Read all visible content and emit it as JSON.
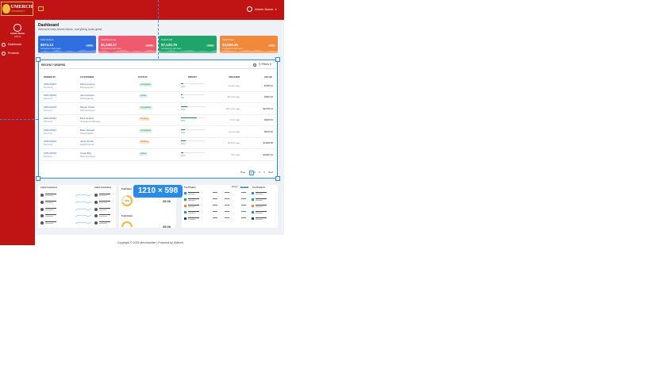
{
  "app": {
    "logo_text": "UMERCH",
    "logo_subtext": "UNIVERSITY",
    "menu_toggle_icon": "menu-icon"
  },
  "sidebar": {
    "user_icon": "user-circle-icon",
    "user_name": "Admin Name",
    "user_role": "Admin",
    "items": [
      {
        "label": "Dashboard",
        "icon": "dashboard-icon"
      },
      {
        "label": "Products",
        "icon": "box-icon"
      }
    ]
  },
  "header": {
    "admin_label": "Admin Name",
    "admin_icon": "user-circle-icon",
    "chevron_icon": "chevron-down-icon"
  },
  "page": {
    "title": "Dashboard",
    "subtitle": "Welcome back Admin Name, everything looks great."
  },
  "stats": [
    {
      "label": "Total Orders",
      "value": "$574.12",
      "sub": "Compared to last week",
      "pill": "+12%",
      "color": "#2f6fe0"
    },
    {
      "label": "Total Revenue",
      "value": "$1,238.17",
      "sub": "Compared to last week",
      "pill": "+8.5%",
      "color": "#ef5a6f"
    },
    {
      "label": "Total Profit",
      "value": "$7,120.76",
      "sub": "Compared to last week",
      "pill": "+14%",
      "color": "#1fa56a"
    },
    {
      "label": "Total Users",
      "value": "$4,820.35",
      "sub": "Compared to last week",
      "pill": "+6%",
      "color": "#f2883a"
    }
  ],
  "orders": {
    "title": "RECENT ORDERS",
    "search_icon": "search-icon",
    "filters_label": "Filters",
    "columns": [
      "ORDER ID",
      "CUSTOMER",
      "STATUS",
      "PROFIT",
      "CREATED",
      "VALUE"
    ],
    "rows": [
      {
        "id": "ORD-00001",
        "type": "Premium",
        "customer": "Marie Antoine",
        "role": "Photographer",
        "status": "Completed",
        "status_class": "completed",
        "profit": 10,
        "created": "1 hours ago",
        "value": "$768.91"
      },
      {
        "id": "ORD-00024",
        "type": "Premium",
        "customer": "Jane Roberts",
        "role": "Photographer",
        "status": "Active",
        "status_class": "active",
        "profit": 5,
        "created": "28 mins ago",
        "value": "$992,06"
      },
      {
        "id": "ORD-00023",
        "type": "Premium",
        "customer": "Megan Fisher",
        "role": "Web developer",
        "status": "Completed",
        "status_class": "completed",
        "profit": 25,
        "created": "7hrs mins ago",
        "value": "$2378.44"
      },
      {
        "id": "ORD-00022",
        "type": "Premium",
        "customer": "Ezra Jenkins",
        "role": "Operations Manager",
        "status": "Pending",
        "status_class": "pending",
        "profit": 65,
        "created": "5 hrs ago",
        "value": "$468.52"
      },
      {
        "id": "ORD-00021",
        "type": "Premium",
        "customer": "Brian Stewart",
        "role": "Photographer",
        "status": "Completed",
        "status_class": "completed",
        "profit": 15,
        "created": "8 mins ago",
        "value": "$976.82"
      },
      {
        "id": "ORD-00020",
        "type": "Premium",
        "customer": "Jamie Fisher",
        "role": "Digital Painter",
        "status": "Pending",
        "status_class": "pending",
        "profit": 20,
        "created": "29 mins ago",
        "value": "$1938.68"
      },
      {
        "id": "ORD-00019",
        "type": "Premium",
        "customer": "Oscar Bay",
        "role": "Web Developer",
        "status": "Active",
        "status_class": "active",
        "profit": 10,
        "created": "7hrs ago",
        "value": "$2200.91"
      }
    ],
    "pagination": {
      "prev": "Prev",
      "pages": [
        "1",
        "2",
        "3",
        "4"
      ],
      "active": "1",
      "next": "Next"
    }
  },
  "overlay": {
    "size_label": "1210 × 598"
  },
  "bottom": {
    "panel1": {
      "title1": "Latest Customers",
      "title2": "Latest Customers"
    },
    "panel2": {
      "title1": "Total Sales",
      "gauge_value": "70%",
      "amount": "45.3k",
      "title2": "Total Orders",
      "amount2": "45.3k"
    },
    "panel3": {
      "title": "Top Product",
      "btn1": "Weekly",
      "btn2": "Monthly",
      "title2": "Top Products"
    }
  },
  "footer": {
    "text": "Copyright © 2025 Merchandise | Powered by UMerch"
  }
}
